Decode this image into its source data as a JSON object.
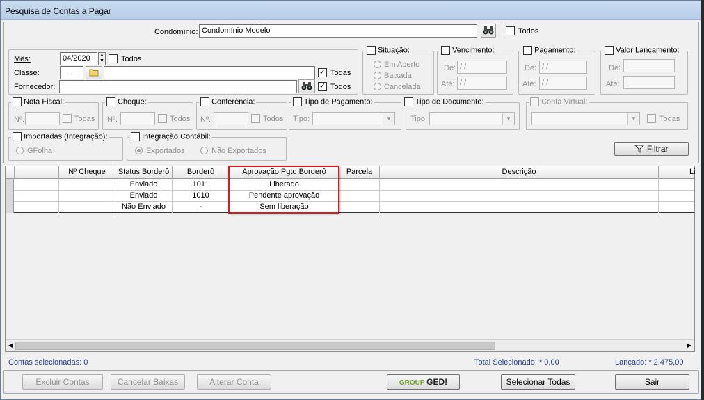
{
  "window": {
    "title": "Pesquisa de Contas a Pagar"
  },
  "top": {
    "condominio_label": "Condomínio:",
    "condominio_value": "Condomínio Modelo",
    "todos_label": "Todos"
  },
  "filters": {
    "mes_label": "Mês:",
    "mes_value": "04/2020",
    "mes_todos": "Todos",
    "classe_label": "Classe:",
    "classe_value": ".",
    "classe_todas": "Todas",
    "fornecedor_label": "Fornecedor:",
    "fornecedor_todos": "Todos"
  },
  "situacao": {
    "title": "Situação:",
    "opt1": "Em Aberto",
    "opt2": "Baixada",
    "opt3": "Cancelada"
  },
  "vencimento": {
    "title": "Vencimento:",
    "de": "De:",
    "ate": "Até:",
    "de_value": " / /",
    "ate_value": " / /"
  },
  "pagamento": {
    "title": "Pagamento:",
    "de": "De:",
    "ate": "Até:",
    "de_value": " / /",
    "ate_value": " / /"
  },
  "valor": {
    "title": "Valor Lançamento:",
    "de": "De:",
    "ate": "Até:"
  },
  "nota": {
    "title": "Nota Fiscal:",
    "no": "Nº:",
    "todas": "Todas"
  },
  "cheque": {
    "title": "Cheque:",
    "no": "Nº:",
    "todos": "Todos"
  },
  "conferencia": {
    "title": "Conferência:",
    "no": "Nº:",
    "todos": "Todos"
  },
  "tipo_pagamento": {
    "title": "Tipo de Pagamento:",
    "tipo": "Tipo:"
  },
  "tipo_documento": {
    "title": "Tipo de Documento:",
    "tipo": "Tipo:"
  },
  "conta_virtual": {
    "title": "Conta Virtual:",
    "todas": "Todas"
  },
  "importadas": {
    "title": "Importadas (Integração):",
    "opt": "GFolha"
  },
  "integracao": {
    "title": "Integração Contábil:",
    "opt1": "Exportados",
    "opt2": "Não Exportados"
  },
  "filtrar_label": "Filtrar",
  "grid": {
    "headers": [
      "Nº Cheque",
      "Status Borderô",
      "Borderô",
      "Aprovação Pgto Borderô",
      "Parcela",
      "Descrição",
      "Li"
    ],
    "rows": [
      {
        "status": "Enviado",
        "bordero": "1011",
        "aprovacao": "Liberado"
      },
      {
        "status": "Enviado",
        "bordero": "1010",
        "aprovacao": "Pendente aprovação"
      },
      {
        "status": "Não Enviado",
        "bordero": "-",
        "aprovacao": "Sem liberação"
      }
    ]
  },
  "footer": {
    "contas_selecionadas": "Contas selecionadas: 0",
    "total_selecionado": "Total Selecionado: * 0,00",
    "lancado": "Lançado: * 2.475,00"
  },
  "buttons": {
    "excluir": "Excluir Contas",
    "cancelar": "Cancelar Baixas",
    "alterar": "Alterar Conta",
    "ged_group": "GROUP",
    "ged_ged": "GED!",
    "selecionar": "Selecionar Todas",
    "sair": "Sair"
  }
}
